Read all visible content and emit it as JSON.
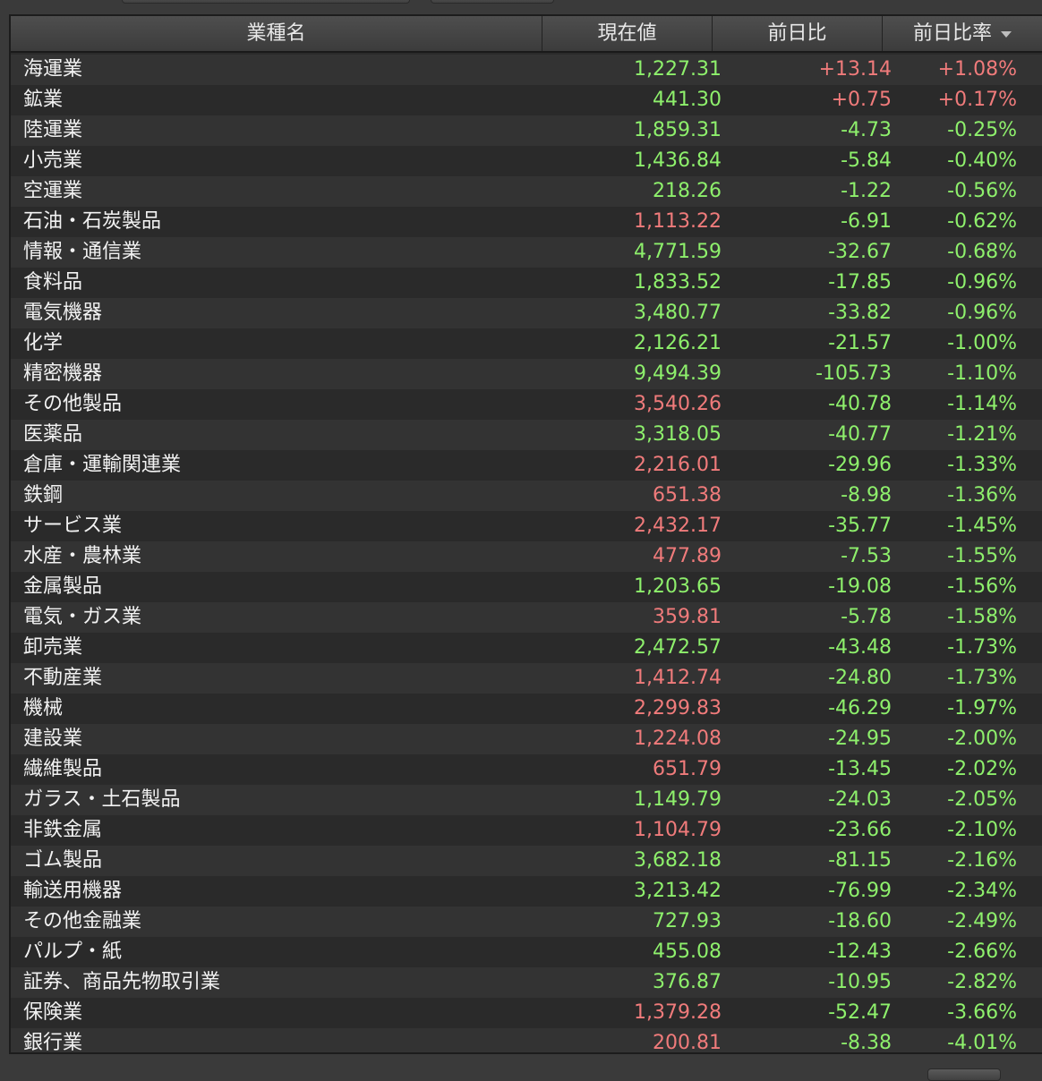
{
  "header": {
    "col_name": "業種名",
    "col_price": "現在値",
    "col_change": "前日比",
    "col_pct": "前日比率"
  },
  "rows": [
    {
      "name": "海運業",
      "price": "1,227.31",
      "price_color": "green",
      "change": "+13.14",
      "pct": "+1.08%"
    },
    {
      "name": "鉱業",
      "price": "441.30",
      "price_color": "green",
      "change": "+0.75",
      "pct": "+0.17%"
    },
    {
      "name": "陸運業",
      "price": "1,859.31",
      "price_color": "green",
      "change": "-4.73",
      "pct": "-0.25%"
    },
    {
      "name": "小売業",
      "price": "1,436.84",
      "price_color": "green",
      "change": "-5.84",
      "pct": "-0.40%"
    },
    {
      "name": "空運業",
      "price": "218.26",
      "price_color": "green",
      "change": "-1.22",
      "pct": "-0.56%"
    },
    {
      "name": "石油・石炭製品",
      "price": "1,113.22",
      "price_color": "red",
      "change": "-6.91",
      "pct": "-0.62%"
    },
    {
      "name": "情報・通信業",
      "price": "4,771.59",
      "price_color": "green",
      "change": "-32.67",
      "pct": "-0.68%"
    },
    {
      "name": "食料品",
      "price": "1,833.52",
      "price_color": "green",
      "change": "-17.85",
      "pct": "-0.96%"
    },
    {
      "name": "電気機器",
      "price": "3,480.77",
      "price_color": "green",
      "change": "-33.82",
      "pct": "-0.96%"
    },
    {
      "name": "化学",
      "price": "2,126.21",
      "price_color": "green",
      "change": "-21.57",
      "pct": "-1.00%"
    },
    {
      "name": "精密機器",
      "price": "9,494.39",
      "price_color": "green",
      "change": "-105.73",
      "pct": "-1.10%"
    },
    {
      "name": "その他製品",
      "price": "3,540.26",
      "price_color": "red",
      "change": "-40.78",
      "pct": "-1.14%"
    },
    {
      "name": "医薬品",
      "price": "3,318.05",
      "price_color": "green",
      "change": "-40.77",
      "pct": "-1.21%"
    },
    {
      "name": "倉庫・運輸関連業",
      "price": "2,216.01",
      "price_color": "red",
      "change": "-29.96",
      "pct": "-1.33%"
    },
    {
      "name": "鉄鋼",
      "price": "651.38",
      "price_color": "red",
      "change": "-8.98",
      "pct": "-1.36%"
    },
    {
      "name": "サービス業",
      "price": "2,432.17",
      "price_color": "red",
      "change": "-35.77",
      "pct": "-1.45%"
    },
    {
      "name": "水産・農林業",
      "price": "477.89",
      "price_color": "red",
      "change": "-7.53",
      "pct": "-1.55%"
    },
    {
      "name": "金属製品",
      "price": "1,203.65",
      "price_color": "green",
      "change": "-19.08",
      "pct": "-1.56%"
    },
    {
      "name": "電気・ガス業",
      "price": "359.81",
      "price_color": "red",
      "change": "-5.78",
      "pct": "-1.58%"
    },
    {
      "name": "卸売業",
      "price": "2,472.57",
      "price_color": "green",
      "change": "-43.48",
      "pct": "-1.73%"
    },
    {
      "name": "不動産業",
      "price": "1,412.74",
      "price_color": "red",
      "change": "-24.80",
      "pct": "-1.73%"
    },
    {
      "name": "機械",
      "price": "2,299.83",
      "price_color": "red",
      "change": "-46.29",
      "pct": "-1.97%"
    },
    {
      "name": "建設業",
      "price": "1,224.08",
      "price_color": "red",
      "change": "-24.95",
      "pct": "-2.00%"
    },
    {
      "name": "繊維製品",
      "price": "651.79",
      "price_color": "red",
      "change": "-13.45",
      "pct": "-2.02%"
    },
    {
      "name": "ガラス・土石製品",
      "price": "1,149.79",
      "price_color": "green",
      "change": "-24.03",
      "pct": "-2.05%"
    },
    {
      "name": "非鉄金属",
      "price": "1,104.79",
      "price_color": "red",
      "change": "-23.66",
      "pct": "-2.10%"
    },
    {
      "name": "ゴム製品",
      "price": "3,682.18",
      "price_color": "green",
      "change": "-81.15",
      "pct": "-2.16%"
    },
    {
      "name": "輸送用機器",
      "price": "3,213.42",
      "price_color": "green",
      "change": "-76.99",
      "pct": "-2.34%"
    },
    {
      "name": "その他金融業",
      "price": "727.93",
      "price_color": "green",
      "change": "-18.60",
      "pct": "-2.49%"
    },
    {
      "name": "パルプ・紙",
      "price": "455.08",
      "price_color": "green",
      "change": "-12.43",
      "pct": "-2.66%"
    },
    {
      "name": "証券、商品先物取引業",
      "price": "376.87",
      "price_color": "green",
      "change": "-10.95",
      "pct": "-2.82%"
    },
    {
      "name": "保険業",
      "price": "1,379.28",
      "price_color": "red",
      "change": "-52.47",
      "pct": "-3.66%"
    },
    {
      "name": "銀行業",
      "price": "200.81",
      "price_color": "red",
      "change": "-8.38",
      "pct": "-4.01%"
    }
  ],
  "colors": {
    "green": "#8ef06c",
    "red": "#f07b7b",
    "header_bg": "#454545",
    "row_odd": "#333333",
    "row_even": "#2a2a2a"
  },
  "icons": {
    "sort": "sort-descending-icon"
  }
}
